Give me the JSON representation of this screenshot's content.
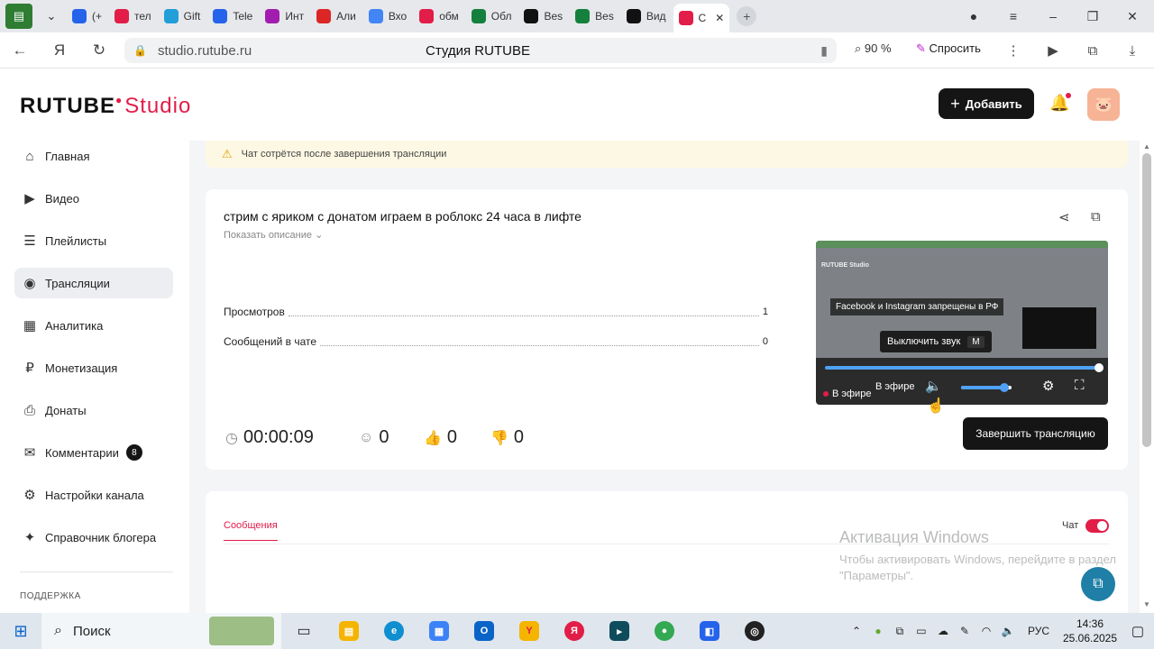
{
  "browser": {
    "tabs": [
      {
        "label": "(+",
        "color": "#2563eb",
        "icon": "rutube-tab-icon"
      },
      {
        "label": "тел",
        "color": "#e11d48",
        "icon": "yandex-tab-icon"
      },
      {
        "label": "Gift",
        "color": "#229ed9",
        "icon": "telegram-tab-icon"
      },
      {
        "label": "Tele",
        "color": "#2563eb",
        "icon": "telegram-web-tab-icon"
      },
      {
        "label": "Инт",
        "color": "#a21caf",
        "icon": "wildberries-tab-icon"
      },
      {
        "label": "Али",
        "color": "#dc2626",
        "icon": "aliexpress-tab-icon"
      },
      {
        "label": "Вхо",
        "color": "#4285f4",
        "icon": "google-tab-icon"
      },
      {
        "label": "обм",
        "color": "#e11d48",
        "icon": "yandex-tab-icon"
      },
      {
        "label": "Обл",
        "color": "#15803d",
        "icon": "bc-tab-icon"
      },
      {
        "label": "Bes",
        "color": "#111111",
        "icon": "doc-tab-icon"
      },
      {
        "label": "Bes",
        "color": "#15803d",
        "icon": "bc-tab-icon"
      },
      {
        "label": "Вид",
        "color": "#111111",
        "icon": "rutube-r-tab-icon"
      },
      {
        "label": "С",
        "color": "#e11d48",
        "icon": "studio-tab-icon",
        "active": true
      }
    ],
    "url_host": "studio.rutube.ru",
    "page_title": "Студия RUTUBE",
    "zoom": "90 %",
    "ask_label": "Спросить"
  },
  "app": {
    "logo_main": "RUTUBE",
    "logo_studio": "Studio",
    "add_label": "Добавить"
  },
  "sidebar": {
    "items": [
      {
        "label": "Главная",
        "icon": "home-icon",
        "glyph": "⌂"
      },
      {
        "label": "Видео",
        "icon": "video-icon",
        "glyph": "▶"
      },
      {
        "label": "Плейлисты",
        "icon": "playlist-icon",
        "glyph": "☰"
      },
      {
        "label": "Трансляции",
        "icon": "broadcast-icon",
        "glyph": "◉",
        "active": true
      },
      {
        "label": "Аналитика",
        "icon": "analytics-icon",
        "glyph": "▦"
      },
      {
        "label": "Монетизация",
        "icon": "monetization-icon",
        "glyph": "₽"
      },
      {
        "label": "Донаты",
        "icon": "donate-icon",
        "glyph": "⎙"
      },
      {
        "label": "Комментарии",
        "icon": "comments-icon",
        "glyph": "✉",
        "badge": "8"
      },
      {
        "label": "Настройки канала",
        "icon": "settings-icon",
        "glyph": "⚙"
      },
      {
        "label": "Справочник блогера",
        "icon": "handbook-icon",
        "glyph": "✦"
      }
    ],
    "section_support": "ПОДДЕРЖКА"
  },
  "main": {
    "warning": "Чат сотрётся после завершения трансляции",
    "stream_title": "стрим с яриком с донатом играем в роблокс 24 часа в лифте",
    "show_description": "Показать описание",
    "stats": [
      {
        "label": "Просмотров",
        "value": "1"
      },
      {
        "label": "Сообщений в чате",
        "value": "0"
      }
    ],
    "metrics": {
      "duration": "00:00:09",
      "viewers": "0",
      "likes": "0",
      "dislikes": "0"
    },
    "player": {
      "notice": "Facebook и Instagram запрещены в РФ",
      "mute_tooltip": "Выключить звук",
      "mute_key": "M",
      "live_label": "В эфире",
      "live_label_2": "В эфире",
      "screen_logo": "RUTUBE Studio",
      "volume_fraction": 0.85
    },
    "end_button": "Завершить трансляцию",
    "messages_tab": "Сообщения",
    "chat_label": "Чат"
  },
  "watermark": {
    "title": "Активация Windows",
    "subtitle": "Чтобы активировать Windows, перейдите в раздел \"Параметры\"."
  },
  "taskbar": {
    "search_label": "Поиск",
    "lang": "РУС",
    "time": "14:36",
    "date": "25.06.2025"
  },
  "colors": {
    "accent": "#e11d48",
    "dark_button": "#151515"
  }
}
